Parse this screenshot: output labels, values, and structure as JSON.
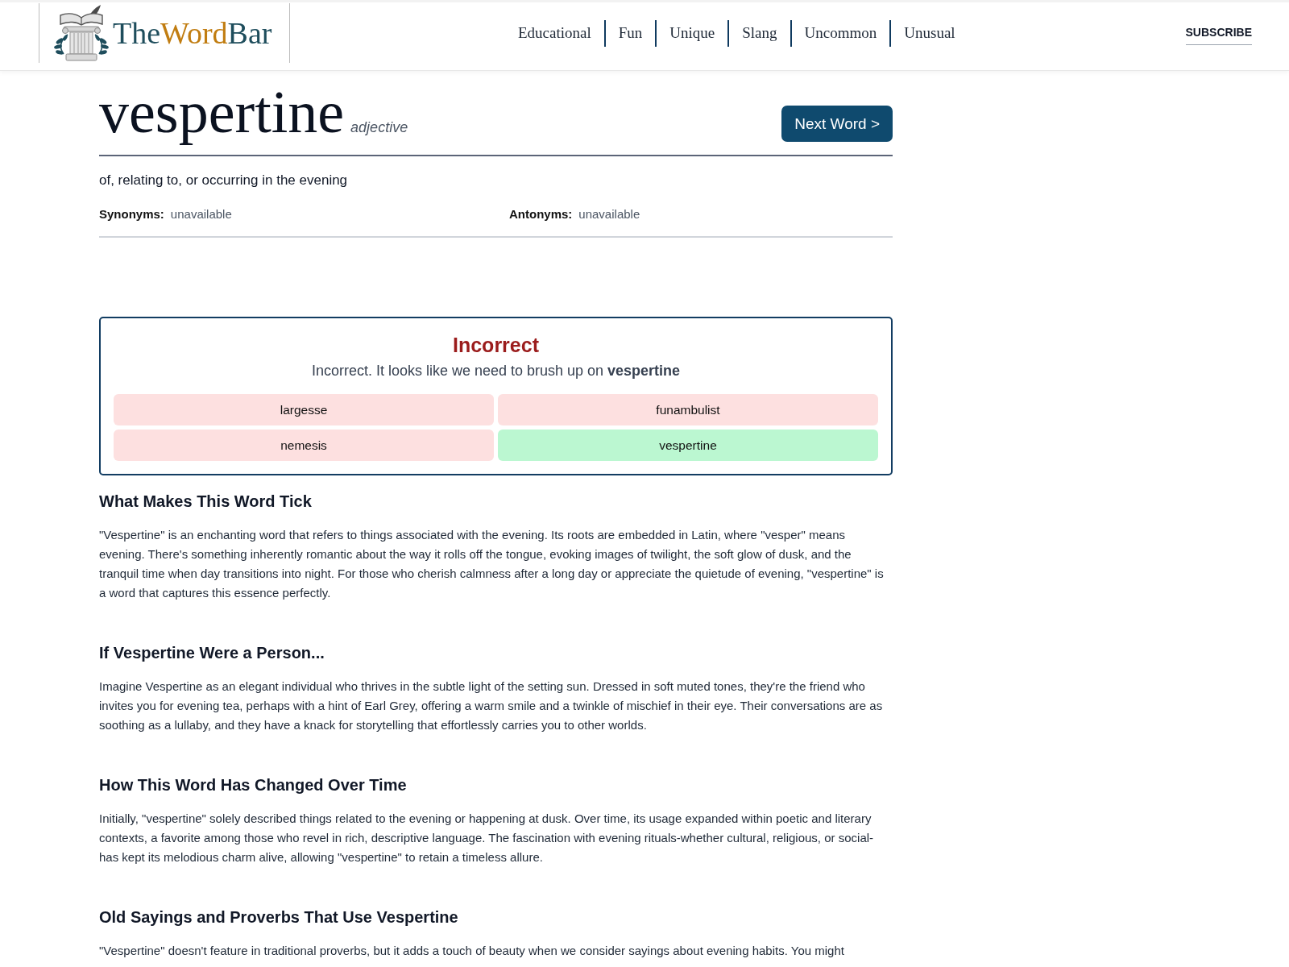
{
  "header": {
    "logo": {
      "segments": [
        {
          "text": "The",
          "color": "#1e4d5c"
        },
        {
          "text": "Word",
          "color": "#c17d11"
        },
        {
          "text": "Bar",
          "color": "#1e4d5c"
        }
      ]
    },
    "nav": [
      "Educational",
      "Fun",
      "Unique",
      "Slang",
      "Uncommon",
      "Unusual"
    ],
    "subscribe": "SUBSCRIBE"
  },
  "word": {
    "text": "vespertine",
    "part_of_speech": "adjective",
    "next_button": "Next Word >",
    "definition": "of, relating to, or occurring in the evening",
    "synonyms": {
      "label": "Synonyms:",
      "value": "unavailable"
    },
    "antonyms": {
      "label": "Antonyms:",
      "value": "unavailable"
    }
  },
  "quiz": {
    "result": "Incorrect",
    "correct": false,
    "message": "Incorrect. It looks like we need to brush up on **vespertine**",
    "options": [
      {
        "label": "largesse",
        "correct": false
      },
      {
        "label": "funambulist",
        "correct": false
      },
      {
        "label": "nemesis",
        "correct": false
      },
      {
        "label": "vespertine",
        "correct": true
      }
    ]
  },
  "sections": [
    {
      "heading": "What Makes This Word Tick",
      "body": "\"Vespertine\" is an enchanting word that refers to things associated with the evening. Its roots are embedded in Latin, where \"vesper\" means evening. There's something inherently romantic about the way it rolls off the tongue, evoking images of twilight, the soft glow of dusk, and the tranquil time when day transitions into night. For those who cherish calmness after a long day or appreciate the quietude of evening, \"vespertine\" is a word that captures this essence perfectly."
    },
    {
      "heading": "If Vespertine Were a Person...",
      "body": "Imagine Vespertine as an elegant individual who thrives in the subtle light of the setting sun. Dressed in soft muted tones, they're the friend who invites you for evening tea, perhaps with a hint of Earl Grey, offering a warm smile and a twinkle of mischief in their eye. Their conversations are as soothing as a lullaby, and they have a knack for storytelling that effortlessly carries you to other worlds."
    },
    {
      "heading": "How This Word Has Changed Over Time",
      "body": "Initially, \"vespertine\" solely described things related to the evening or happening at dusk. Over time, its usage expanded within poetic and literary contexts, a favorite among those who revel in rich, descriptive language. The fascination with evening rituals-whether cultural, religious, or social-has kept its melodious charm alive, allowing \"vespertine\" to retain a timeless allure."
    },
    {
      "heading": "Old Sayings and Proverbs That Use Vespertine",
      "body": "\"Vespertine\" doesn't feature in traditional proverbs, but it adds a touch of beauty when we consider sayings about evening habits. You might"
    }
  ]
}
